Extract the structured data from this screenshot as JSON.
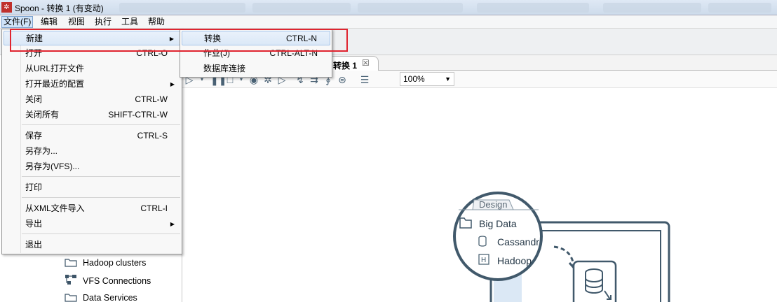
{
  "window": {
    "title": "Spoon - 转换 1 (有变动)",
    "app_icon": "spoon-logo-icon"
  },
  "menubar": {
    "items": [
      {
        "label": "文件(F)",
        "active": true
      },
      {
        "label": "编辑"
      },
      {
        "label": "视图"
      },
      {
        "label": "执行"
      },
      {
        "label": "工具"
      },
      {
        "label": "帮助"
      }
    ]
  },
  "file_menu": {
    "items": [
      {
        "label": "新建",
        "shortcut": "",
        "submenu": true
      },
      {
        "label": "打开",
        "shortcut": "CTRL-O"
      },
      {
        "label": "从URL打开文件",
        "shortcut": ""
      },
      {
        "label": "打开最近的配置",
        "shortcut": "",
        "submenu": true
      },
      {
        "label": "关闭",
        "shortcut": "CTRL-W"
      },
      {
        "label": "关闭所有",
        "shortcut": "SHIFT-CTRL-W"
      },
      {
        "label": "保存",
        "shortcut": "CTRL-S"
      },
      {
        "label": "另存为...",
        "shortcut": ""
      },
      {
        "label": "另存为(VFS)...",
        "shortcut": ""
      },
      {
        "label": "打印",
        "shortcut": ""
      },
      {
        "label": "从XML文件导入",
        "shortcut": "CTRL-I"
      },
      {
        "label": "导出",
        "shortcut": "",
        "submenu": true
      },
      {
        "label": "退出",
        "shortcut": ""
      }
    ]
  },
  "new_submenu": {
    "items": [
      {
        "label": "转换",
        "shortcut": "CTRL-N"
      },
      {
        "label": "作业(J)",
        "shortcut": "CTRL-ALT-N"
      },
      {
        "label": "数据库连接",
        "shortcut": ""
      }
    ]
  },
  "tab": {
    "label": "转换 1"
  },
  "canvas_toolbar": {
    "zoom": "100%"
  },
  "tree": {
    "items": [
      {
        "label": "Hadoop clusters",
        "icon": "folder-icon"
      },
      {
        "label": "VFS Connections",
        "icon": "vfs-connections-icon"
      },
      {
        "label": "Data Services",
        "icon": "folder-icon"
      }
    ]
  },
  "design_illustration": {
    "tab": "Design",
    "folder": "Big Data",
    "steps": [
      "Cassandr",
      "Hadoop"
    ]
  },
  "colors": {
    "highlight_box": "#e0242f",
    "accent": "#4a6275"
  }
}
